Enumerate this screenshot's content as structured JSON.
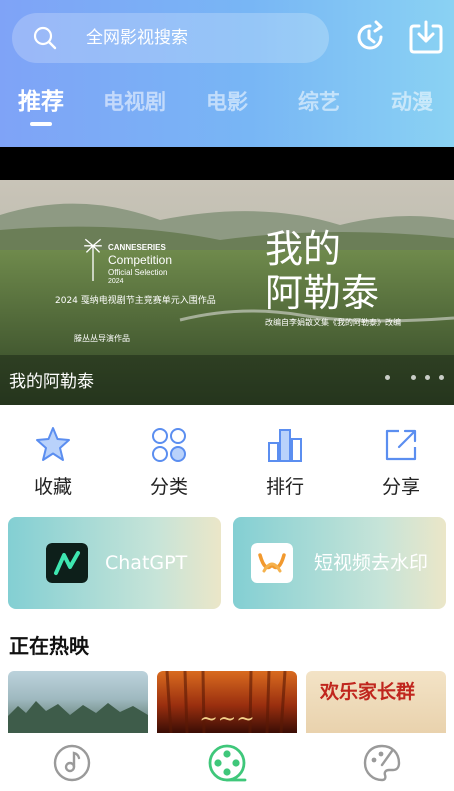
{
  "header": {
    "search_placeholder": "全网影视搜索",
    "history_icon": "history-refresh-icon",
    "download_icon": "download-icon"
  },
  "tabs": [
    {
      "label": "推荐",
      "active": true
    },
    {
      "label": "电视剧",
      "active": false
    },
    {
      "label": "电影",
      "active": false
    },
    {
      "label": "综艺",
      "active": false
    },
    {
      "label": "动漫",
      "active": false
    }
  ],
  "banner": {
    "caption": "我的阿勒泰",
    "poster_title": "我的\n阿勒泰",
    "festival_line1": "CANNESERIES",
    "festival_line2": "Competition",
    "festival_line3": "Official Selection",
    "festival_year": "2024",
    "festival_cn": "2024 戛纳电视剧节主竞赛单元入围作品",
    "adapted_from": "改编自李娟散文集《我的阿勒泰》改编",
    "director_line": "滕丛丛导演作品",
    "page_count": 4
  },
  "quick_actions": [
    {
      "label": "收藏",
      "icon": "star-icon"
    },
    {
      "label": "分类",
      "icon": "grid-category-icon"
    },
    {
      "label": "排行",
      "icon": "bar-ranking-icon"
    },
    {
      "label": "分享",
      "icon": "share-icon"
    }
  ],
  "promos": [
    {
      "label": "ChatGPT",
      "icon": "chatgpt-logo-icon"
    },
    {
      "label": "短视频去水印",
      "icon": "watermark-logo-icon"
    }
  ],
  "now_showing": {
    "title": "正在热映",
    "poster_titles": [
      "",
      "",
      "欢乐家长群"
    ]
  },
  "bottom_nav": [
    {
      "label": "music",
      "icon": "music-disc-icon",
      "active": false
    },
    {
      "label": "video",
      "icon": "film-reel-icon",
      "active": true
    },
    {
      "label": "theme",
      "icon": "palette-icon",
      "active": false
    }
  ],
  "colors": {
    "accent_green": "#3fc77a",
    "header_start": "#7fa3f7",
    "header_end": "#8ad2f3",
    "icon_blue": "#5b8ef0"
  }
}
